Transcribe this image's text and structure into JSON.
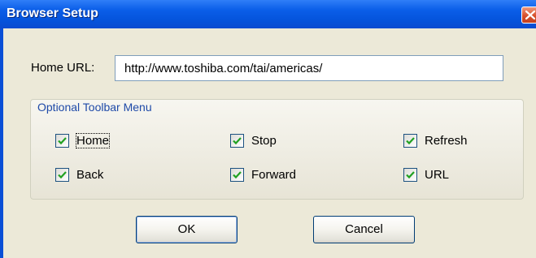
{
  "window": {
    "title": "Browser Setup"
  },
  "form": {
    "home_url_label": "Home URL:",
    "home_url_value": "http://www.toshiba.com/tai/americas/"
  },
  "toolbar_group": {
    "title": "Optional Toolbar Menu",
    "options": [
      {
        "label": "Home",
        "checked": true
      },
      {
        "label": "Stop",
        "checked": true
      },
      {
        "label": "Refresh",
        "checked": true
      },
      {
        "label": "Back",
        "checked": true
      },
      {
        "label": "Forward",
        "checked": true
      },
      {
        "label": "URL",
        "checked": true
      }
    ]
  },
  "buttons": {
    "ok_label": "OK",
    "cancel_label": "Cancel"
  },
  "colors": {
    "titlebar": "#0554dc",
    "close_button": "#d7502c",
    "dialog_background": "#ece9d8",
    "group_title": "#1f4aa8",
    "checkmark": "#21a121"
  }
}
